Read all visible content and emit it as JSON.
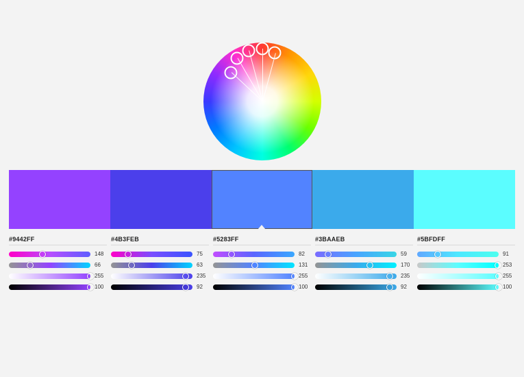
{
  "wheel": {
    "handles": [
      {
        "angle": 227,
        "radius": 62
      },
      {
        "angle": 210,
        "radius": 73
      },
      {
        "angle": 195,
        "radius": 77
      },
      {
        "angle": 180,
        "radius": 77
      },
      {
        "angle": 165,
        "radius": 73
      }
    ]
  },
  "swatches": [
    {
      "hex": "#9442FF",
      "color": "#9442FF",
      "selected": false,
      "sliders": [
        {
          "gradient": "linear-gradient(90deg,#ff00c8,#b84dff,#5e5eff)",
          "pos": 41,
          "value": 148
        },
        {
          "gradient": "linear-gradient(90deg,#949494,#9442ff,#00d4ff)",
          "pos": 26,
          "value": 66
        },
        {
          "gradient": "linear-gradient(90deg,#ffffff,#9442ff)",
          "pos": 100,
          "value": 255
        },
        {
          "gradient": "linear-gradient(90deg,#000000,#9442ff)",
          "pos": 100,
          "value": 100
        }
      ]
    },
    {
      "hex": "#4B3FEB",
      "color": "#4B3FEB",
      "selected": false,
      "sliders": [
        {
          "gradient": "linear-gradient(90deg,#ff00c8,#7a4dff,#3a54ff)",
          "pos": 21,
          "value": 75
        },
        {
          "gradient": "linear-gradient(90deg,#949494,#4b3feb,#00d4ff)",
          "pos": 25,
          "value": 63
        },
        {
          "gradient": "linear-gradient(90deg,#ffffff,#4b3feb)",
          "pos": 92,
          "value": 235
        },
        {
          "gradient": "linear-gradient(90deg,#000000,#4b3feb)",
          "pos": 92,
          "value": 92
        }
      ]
    },
    {
      "hex": "#5283FF",
      "color": "#5283FF",
      "selected": true,
      "sliders": [
        {
          "gradient": "linear-gradient(90deg,#c24dff,#5b66ff,#3aa8ff)",
          "pos": 23,
          "value": 82
        },
        {
          "gradient": "linear-gradient(90deg,#949494,#5283ff,#00e5ff)",
          "pos": 51,
          "value": 131
        },
        {
          "gradient": "linear-gradient(90deg,#ffffff,#5283ff)",
          "pos": 100,
          "value": 255
        },
        {
          "gradient": "linear-gradient(90deg,#000000,#5283ff)",
          "pos": 100,
          "value": 100
        }
      ]
    },
    {
      "hex": "#3BAAEB",
      "color": "#3BAAEB",
      "selected": false,
      "sliders": [
        {
          "gradient": "linear-gradient(90deg,#7a6bff,#49a4ff,#38d6e6)",
          "pos": 16,
          "value": 59
        },
        {
          "gradient": "linear-gradient(90deg,#949494,#3baaeb,#00f0ff)",
          "pos": 67,
          "value": 170
        },
        {
          "gradient": "linear-gradient(90deg,#ffffff,#3baaeb)",
          "pos": 92,
          "value": 235
        },
        {
          "gradient": "linear-gradient(90deg,#000000,#3baaeb)",
          "pos": 92,
          "value": 92
        }
      ]
    },
    {
      "hex": "#5BFDFF",
      "color": "#5BFDFF",
      "selected": false,
      "sliders": [
        {
          "gradient": "linear-gradient(90deg,#60a8ff,#4de8ff,#4dffef)",
          "pos": 25,
          "value": 91
        },
        {
          "gradient": "linear-gradient(90deg,#c8c8c8,#5bfdff,#00ffff)",
          "pos": 99,
          "value": 253
        },
        {
          "gradient": "linear-gradient(90deg,#ffffff,#5bfdff)",
          "pos": 100,
          "value": 255
        },
        {
          "gradient": "linear-gradient(90deg,#000000,#5bfdff)",
          "pos": 100,
          "value": 100
        }
      ]
    }
  ]
}
